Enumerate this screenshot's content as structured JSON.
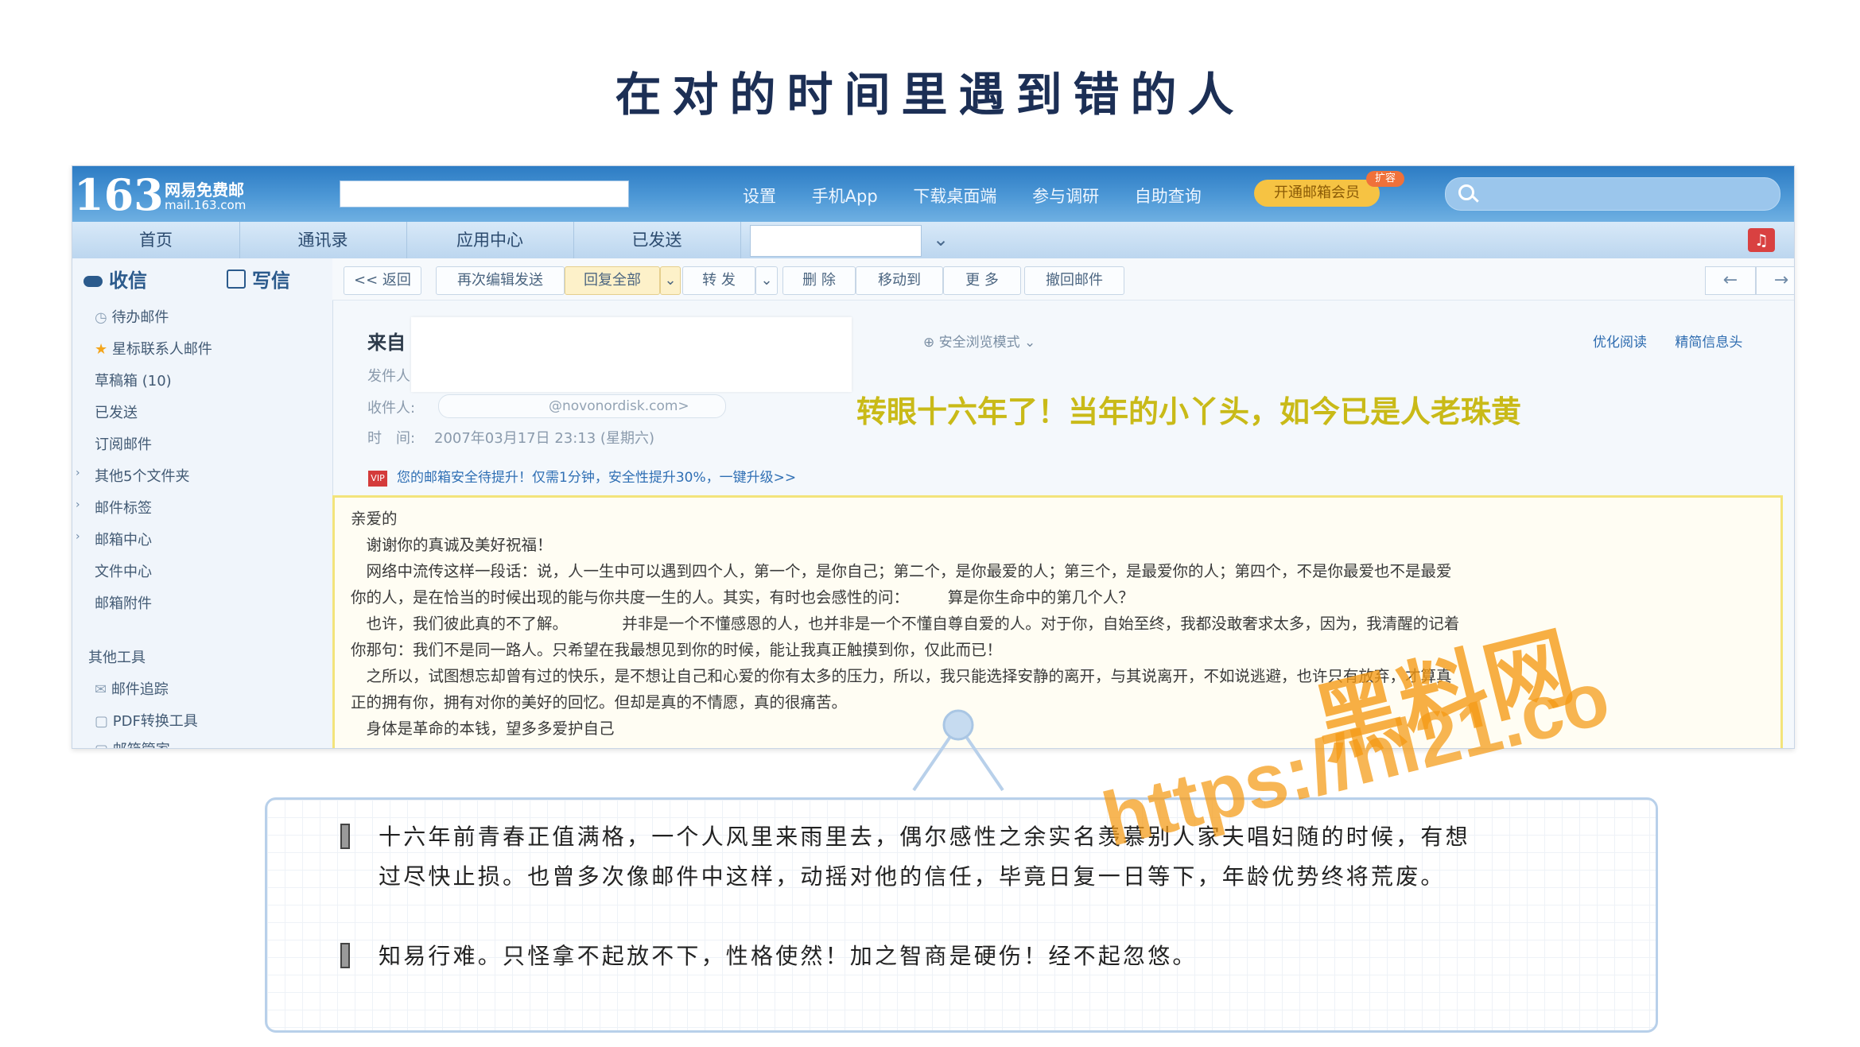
{
  "slide": {
    "title": "在对的时间里遇到错的人"
  },
  "mail": {
    "logo": {
      "number": "163",
      "name": "网易免费邮",
      "domain": "mail.163.com"
    },
    "top_links": [
      "设置",
      "手机App",
      "下载桌面端",
      "参与调研",
      "自助查询"
    ],
    "vip_button": "开通邮箱会员",
    "vip_tag": "扩容",
    "nav_tabs": [
      "首页",
      "通讯录",
      "应用中心",
      "已发送"
    ],
    "sidebar": {
      "inbox": "收信",
      "compose": "写信",
      "items": [
        "待办邮件",
        "星标联系人邮件",
        "草稿箱 (10)",
        "已发送",
        "订阅邮件",
        "其他5个文件夹",
        "邮件标签",
        "邮箱中心",
        "文件中心",
        "邮箱附件"
      ],
      "tools_header": "其他工具",
      "tools": [
        "邮件追踪",
        "PDF转换工具",
        "邮箱管家"
      ]
    },
    "toolbar": {
      "back": "<< 返回",
      "buttons": [
        "再次编辑发送",
        "回复全部",
        "转 发",
        "删 除",
        "移动到",
        "更 多",
        "撤回邮件"
      ]
    },
    "header": {
      "from_label": "来自",
      "sender_label": "发件人",
      "recipient_label": "收件人:",
      "recipient_email": "@novonordisk.com>",
      "time_label": "时　间:",
      "time_value": "2007年03月17日 23:13 (星期六)",
      "safe_mode": "安全浏览模式",
      "links": [
        "优化阅读",
        "精简信息头"
      ]
    },
    "overlay_caption": "转眼十六年了！当年的小丫头，如今已是人老珠黄",
    "notice": {
      "tag": "VIP",
      "text": "您的邮箱安全待提升！仅需1分钟，安全性提升30%，一键升级>>"
    },
    "body_lines": [
      "亲爱的",
      "　谢谢你的真诚及美好祝福！",
      "　网络中流传这样一段话：说，人一生中可以遇到四个人，第一个，是你自己；第二个，是你最爱的人；第三个，是最爱你的人；第四个，不是你最爱也不是最爱",
      "你的人，是在恰当的时候出现的能与你共度一生的人。其实，有时也会感性的问：　　　算是你生命中的第几个人？",
      "　也许，我们彼此真的不了解。　　　　并非是一个不懂感恩的人，也并非是一个不懂自尊自爱的人。对于你，自始至终，我都没敢奢求太多，因为，我清醒的记着",
      "你那句：我们不是同一路人。只希望在我最想见到你的时候，能让我真正触摸到你，仅此而已！",
      "　之所以，试图想忘却曾有过的快乐，是不想让自己和心爱的你有太多的压力，所以，我只能选择安静的离开，与其说离开，不如说逃避，也许只有放弃，才算真",
      "正的拥有你，拥有对你的美好的回忆。但却是真的不情愿，真的很痛苦。",
      "　身体是革命的本钱，望多多爱护自己"
    ]
  },
  "notes": [
    {
      "line1": "十六年前青春正值满格，一个人风里来雨里去，偶尔感性之余实名羡慕别人家夫唱妇随的时候，有想",
      "line2": "过尽快止损。也曾多次像邮件中这样，动摇对他的信任，毕竟日复一日等下，年龄优势终将荒废。"
    },
    {
      "line1": "知易行难。只怪拿不起放不下，性格使然！加之智商是硬伤！经不起忽悠。"
    }
  ],
  "watermark": {
    "name": "黑料网",
    "url": "https://hl21.co"
  },
  "colors": {
    "title": "#1c2f55",
    "mail_topbar": "#2d7cc4",
    "caption": "#c9ba18",
    "watermark": "#f59a14",
    "note_border": "#b8d0ea"
  }
}
